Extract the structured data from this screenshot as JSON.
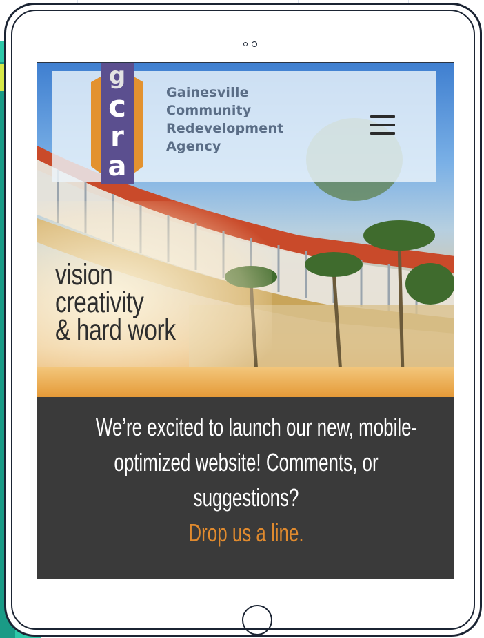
{
  "brand": {
    "logo_letters": [
      "g",
      "c",
      "r",
      "a"
    ],
    "name_lines": [
      "Gainesville",
      "Community",
      "Redevelopment",
      "Agency"
    ]
  },
  "header": {
    "menu_icon": "hamburger-menu-icon"
  },
  "hero": {
    "tagline_lines": [
      "vision",
      "creativity",
      "& hard work"
    ]
  },
  "announcement": {
    "lines": [
      "We’re excited to launch our new, mobile-",
      "optimized website! Comments, or",
      "suggestions?"
    ],
    "link_text": "Drop us a line."
  },
  "colors": {
    "announcement_bg": "#3a3a3a",
    "link": "#e08a2e",
    "logo_orange": "#e3922f",
    "logo_purple": "#5b4f8f",
    "teal_accent": "#2ec9a9"
  }
}
